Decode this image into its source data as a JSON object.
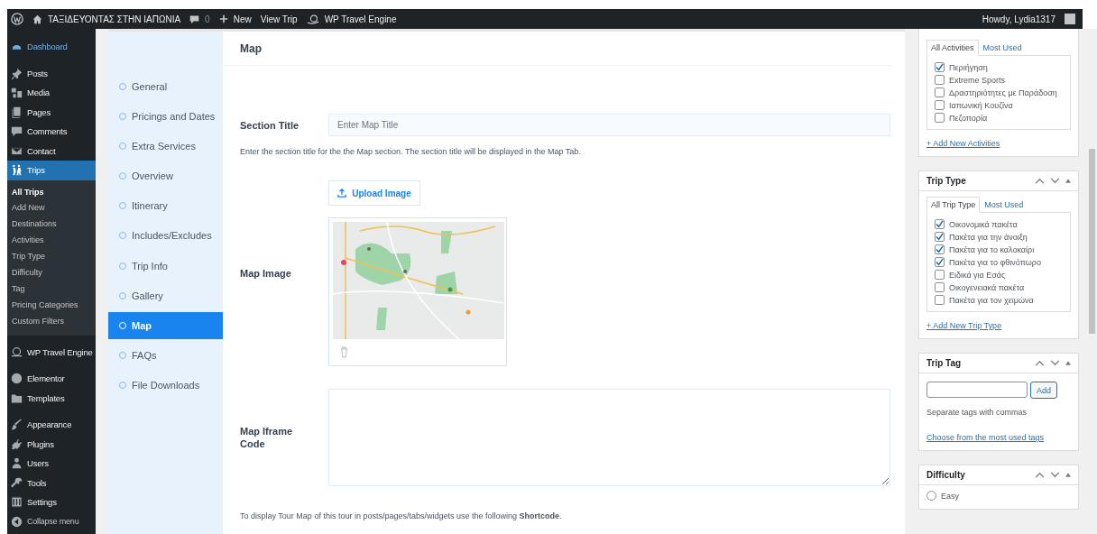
{
  "admin_bar": {
    "site_name": "ΤΑΞΙΔΕΥΟΝΤΑΣ ΣΤΗΝ ΙΑΠΩΝΙΑ",
    "comments": "0",
    "new": "New",
    "view": "View Trip",
    "plugin": "WP Travel Engine",
    "greeting": "Howdy, Lydia1317"
  },
  "sidebar": {
    "items": [
      {
        "label": "Dashboard",
        "selected": false
      },
      {
        "label": "Posts",
        "selected": false
      },
      {
        "label": "Media",
        "selected": false
      },
      {
        "label": "Pages",
        "selected": false
      },
      {
        "label": "Comments",
        "selected": false
      },
      {
        "label": "Contact",
        "selected": false
      },
      {
        "label": "Trips",
        "selected": true,
        "children": [
          {
            "label": "All Trips",
            "selected": true
          },
          {
            "label": "Add New",
            "selected": false
          },
          {
            "label": "Destinations",
            "selected": false
          },
          {
            "label": "Activities",
            "selected": false
          },
          {
            "label": "Trip Type",
            "selected": false
          },
          {
            "label": "Difficulty",
            "selected": false
          },
          {
            "label": "Tag",
            "selected": false
          },
          {
            "label": "Pricing Categories",
            "selected": false
          },
          {
            "label": "Custom Filters",
            "selected": false
          }
        ]
      },
      {
        "label": "WP Travel Engine",
        "selected": false
      },
      {
        "label": "Elementor",
        "selected": false
      },
      {
        "label": "Templates",
        "selected": false
      },
      {
        "label": "Appearance",
        "selected": false
      },
      {
        "label": "Plugins",
        "selected": false
      },
      {
        "label": "Users",
        "selected": false
      },
      {
        "label": "Tools",
        "selected": false
      },
      {
        "label": "Settings",
        "selected": false
      },
      {
        "label": "Collapse menu",
        "selected": false
      }
    ]
  },
  "tabs": [
    {
      "label": "General",
      "selected": false
    },
    {
      "label": "Pricings and Dates",
      "selected": false
    },
    {
      "label": "Extra Services",
      "selected": false
    },
    {
      "label": "Overview",
      "selected": false
    },
    {
      "label": "Itinerary",
      "selected": false
    },
    {
      "label": "Includes/Excludes",
      "selected": false
    },
    {
      "label": "Trip Info",
      "selected": false
    },
    {
      "label": "Gallery",
      "selected": false
    },
    {
      "label": "Map",
      "selected": true
    },
    {
      "label": "FAQs",
      "selected": false
    },
    {
      "label": "File Downloads",
      "selected": false
    }
  ],
  "panel": {
    "title": "Map",
    "section_title": {
      "label": "Section Title",
      "placeholder": "Enter Map Title",
      "help": "Enter the section title for the the Map section. The section title will be displayed in the Map Tab."
    },
    "upload_button": "Upload Image",
    "map_image": {
      "label": "Map Image"
    },
    "iframe": {
      "label": "Map Iframe Code"
    },
    "note": "To display Tour Map of this tour in posts/pages/tabs/widgets use the following **Shortcode**."
  },
  "activities": {
    "tabs": [
      {
        "label": "All Activities",
        "selected": true
      },
      {
        "label": "Most Used",
        "selected": false
      }
    ],
    "items": [
      {
        "label": "Περιήγηση",
        "checked": true
      },
      {
        "label": "Extreme Sports",
        "checked": false
      },
      {
        "label": "Δραστηριότητες με Παράδοση",
        "checked": false
      },
      {
        "label": "Ιαπωνική Κουζίνα",
        "checked": false
      },
      {
        "label": "Πεζοπορία",
        "checked": false
      }
    ],
    "add_link": "+ Add New Activities"
  },
  "trip_type": {
    "title": "Trip Type",
    "tabs": [
      {
        "label": "All Trip Type",
        "selected": true
      },
      {
        "label": "Most Used",
        "selected": false
      }
    ],
    "items": [
      {
        "label": "Οικονομικά πακέτα",
        "checked": true
      },
      {
        "label": "Πακέτα για την άνοιξη",
        "checked": true
      },
      {
        "label": "Πακέτα για το καλοκαίρι",
        "checked": true
      },
      {
        "label": "Πακέτα για το φθινόπωρο",
        "checked": true
      },
      {
        "label": "Ειδικά για Εσάς",
        "checked": false
      },
      {
        "label": "Οικογενειακά πακέτα",
        "checked": false
      },
      {
        "label": "Πακέτα για τον χειμώνα",
        "checked": false
      }
    ],
    "add_link": "+ Add New Trip Type"
  },
  "trip_tag": {
    "title": "Trip Tag",
    "add_button": "Add",
    "hint": "Separate tags with commas",
    "link": "Choose from the most used tags"
  },
  "difficulty": {
    "title": "Difficulty",
    "options": [
      {
        "label": "Easy",
        "selected": false
      }
    ]
  }
}
